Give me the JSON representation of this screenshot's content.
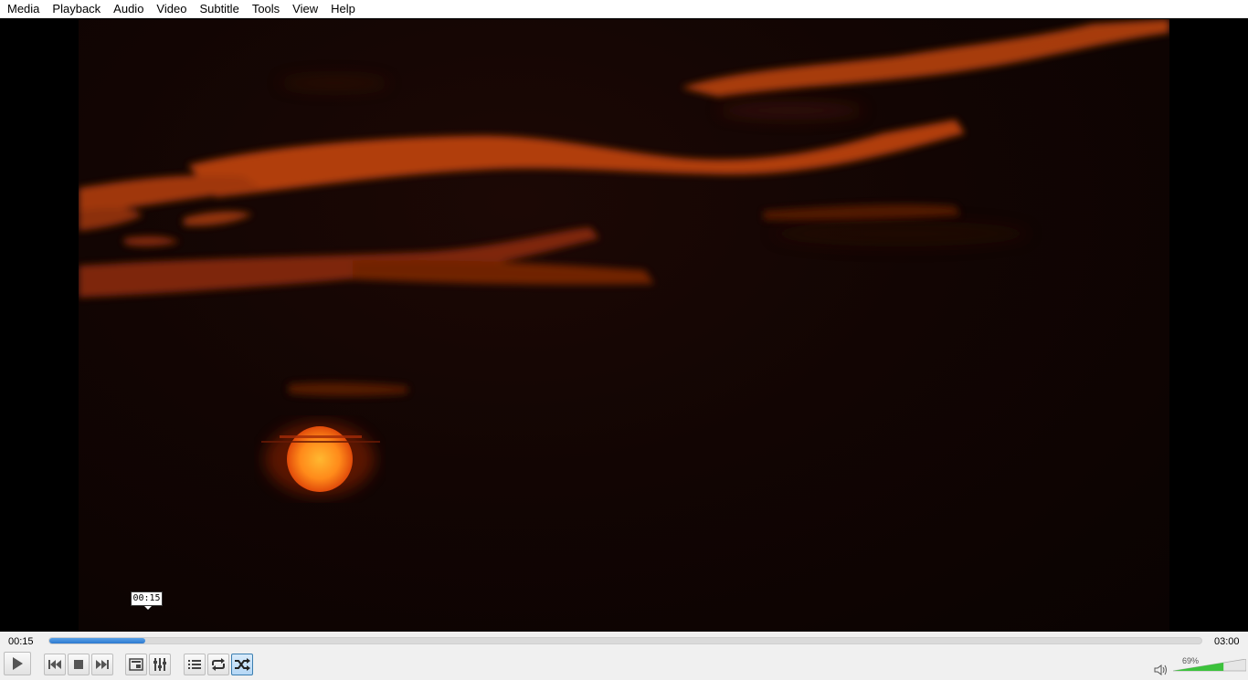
{
  "menu": [
    "Media",
    "Playback",
    "Audio",
    "Video",
    "Subtitle",
    "Tools",
    "View",
    "Help"
  ],
  "tooltip": {
    "time": "00:15"
  },
  "playback": {
    "elapsed": "00:15",
    "total": "03:00",
    "progress_fraction": 0.0833
  },
  "volume": {
    "label": "69%",
    "level_fraction": 0.69,
    "fill_color": "#3cc23c"
  },
  "accent_color": "#2c78cf",
  "icons": {
    "play": "play-icon",
    "prev": "skip-previous-icon",
    "stop": "stop-icon",
    "next": "skip-next-icon",
    "fullscreen": "fullscreen-icon",
    "extended": "extended-settings-icon",
    "playlist": "playlist-icon",
    "loop": "loop-icon",
    "random": "shuffle-icon",
    "mute": "speaker-icon"
  }
}
